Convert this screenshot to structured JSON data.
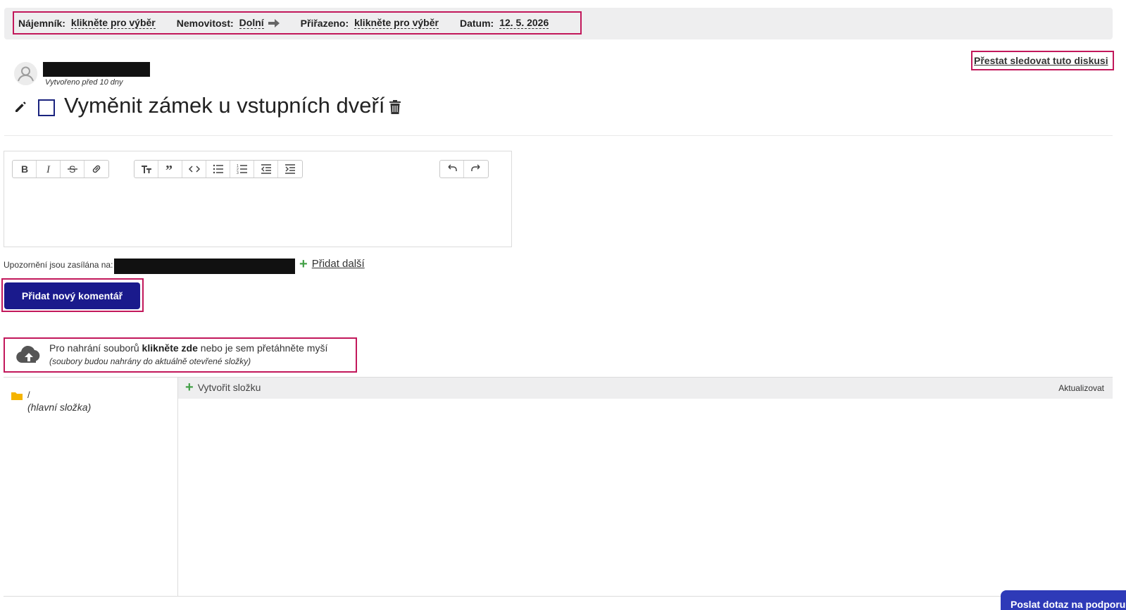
{
  "meta": {
    "tenant_label": "Nájemník:",
    "tenant_value": "klikněte pro výběr",
    "property_label": "Nemovitost:",
    "property_value": "Dolní",
    "assigned_label": "Přiřazeno:",
    "assigned_value": "klikněte pro výběr",
    "date_label": "Datum:",
    "date_value": "12. 5. 2026"
  },
  "unfollow_label": "Přestat sledovat tuto diskusi",
  "author": {
    "created": "Vytvořeno před 10 dny"
  },
  "task": {
    "title": "Vyměnit zámek u vstupních dveří"
  },
  "editor": {
    "toolbar_icons": [
      "bold-icon",
      "italic-icon",
      "strikethrough-icon",
      "link-icon",
      "heading-icon",
      "quote-icon",
      "code-icon",
      "bullet-list-icon",
      "numbered-list-icon",
      "outdent-icon",
      "indent-icon",
      "undo-icon",
      "redo-icon"
    ]
  },
  "notifications": {
    "label": "Upozornění jsou zasílána na:",
    "add_more": "Přidat další"
  },
  "add_comment_button": "Přidat nový komentář",
  "upload": {
    "line1_before": "Pro nahrání souborů ",
    "line1_bold": "klikněte zde",
    "line1_after": " nebo je sem přetáhněte myší",
    "line2": "(soubory budou nahrány do aktuálně otevřené složky)"
  },
  "file_manager": {
    "root_path": "/",
    "root_name": "(hlavní složka)",
    "create_folder": "Vytvořit složku",
    "refresh": "Aktualizovat"
  },
  "support_button": "Poslat dotaz na podporu",
  "colors": {
    "highlight": "#c2185b",
    "primary": "#1a1a8c",
    "support": "#2e3ab8",
    "plus": "#43a047"
  }
}
